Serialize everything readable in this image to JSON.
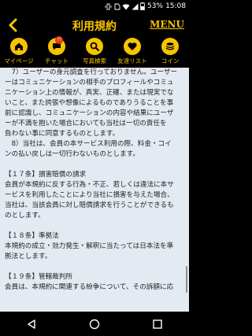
{
  "status": {
    "battery": "53%",
    "time": "15:08"
  },
  "header": {
    "title": "利用規約",
    "menu_label": "MENU"
  },
  "nav": {
    "items": [
      {
        "label": "マイページ"
      },
      {
        "label": "チャット",
        "badge": "!!"
      },
      {
        "label": "写真検索"
      },
      {
        "label": "友達リスト"
      },
      {
        "label": "コイン"
      }
    ]
  },
  "terms": {
    "lines": [
      "　7）ユーザーの身元調査を行っておりません。ユーザー",
      "ーはコミュニケーションの相手のプロフィールやコミュ",
      "ニケーション上の情報が、真実、正確、または現実でな",
      "いこと、また誇張や想像によるものでありうることを事",
      "前に認識し、コミュニケーションの内容や結果にユーザ",
      "ーが不満を抱いた場合においても当社は一切の責任を",
      "負わない事に同意するものとします。",
      "　8）当社は、会員の本サービス利用の際、料金・コイ",
      "ンの払い戻しは一切行わないものとします。",
      "",
      "【１７条】損害賠償の請求",
      "会員が本規約に反する行為・不正、若しくは違法に本サ",
      "ービスを利用したことにより当社に損害を与えた場合、",
      "当社は、当該会員に対し賠償請求を行うことができるも",
      "のとします。",
      "",
      "【１８条】準拠法",
      "本規約の成立・効力発生・解釈に当たっては日本法を準",
      "拠法とします。",
      "",
      "【１９条】管轄裁判所",
      "会員は、本規約に関連する紛争について、その訴額に応"
    ]
  },
  "colors": {
    "accent": "#f6c400",
    "content_bg": "#e4eaf2",
    "badge": "#e83a14"
  }
}
